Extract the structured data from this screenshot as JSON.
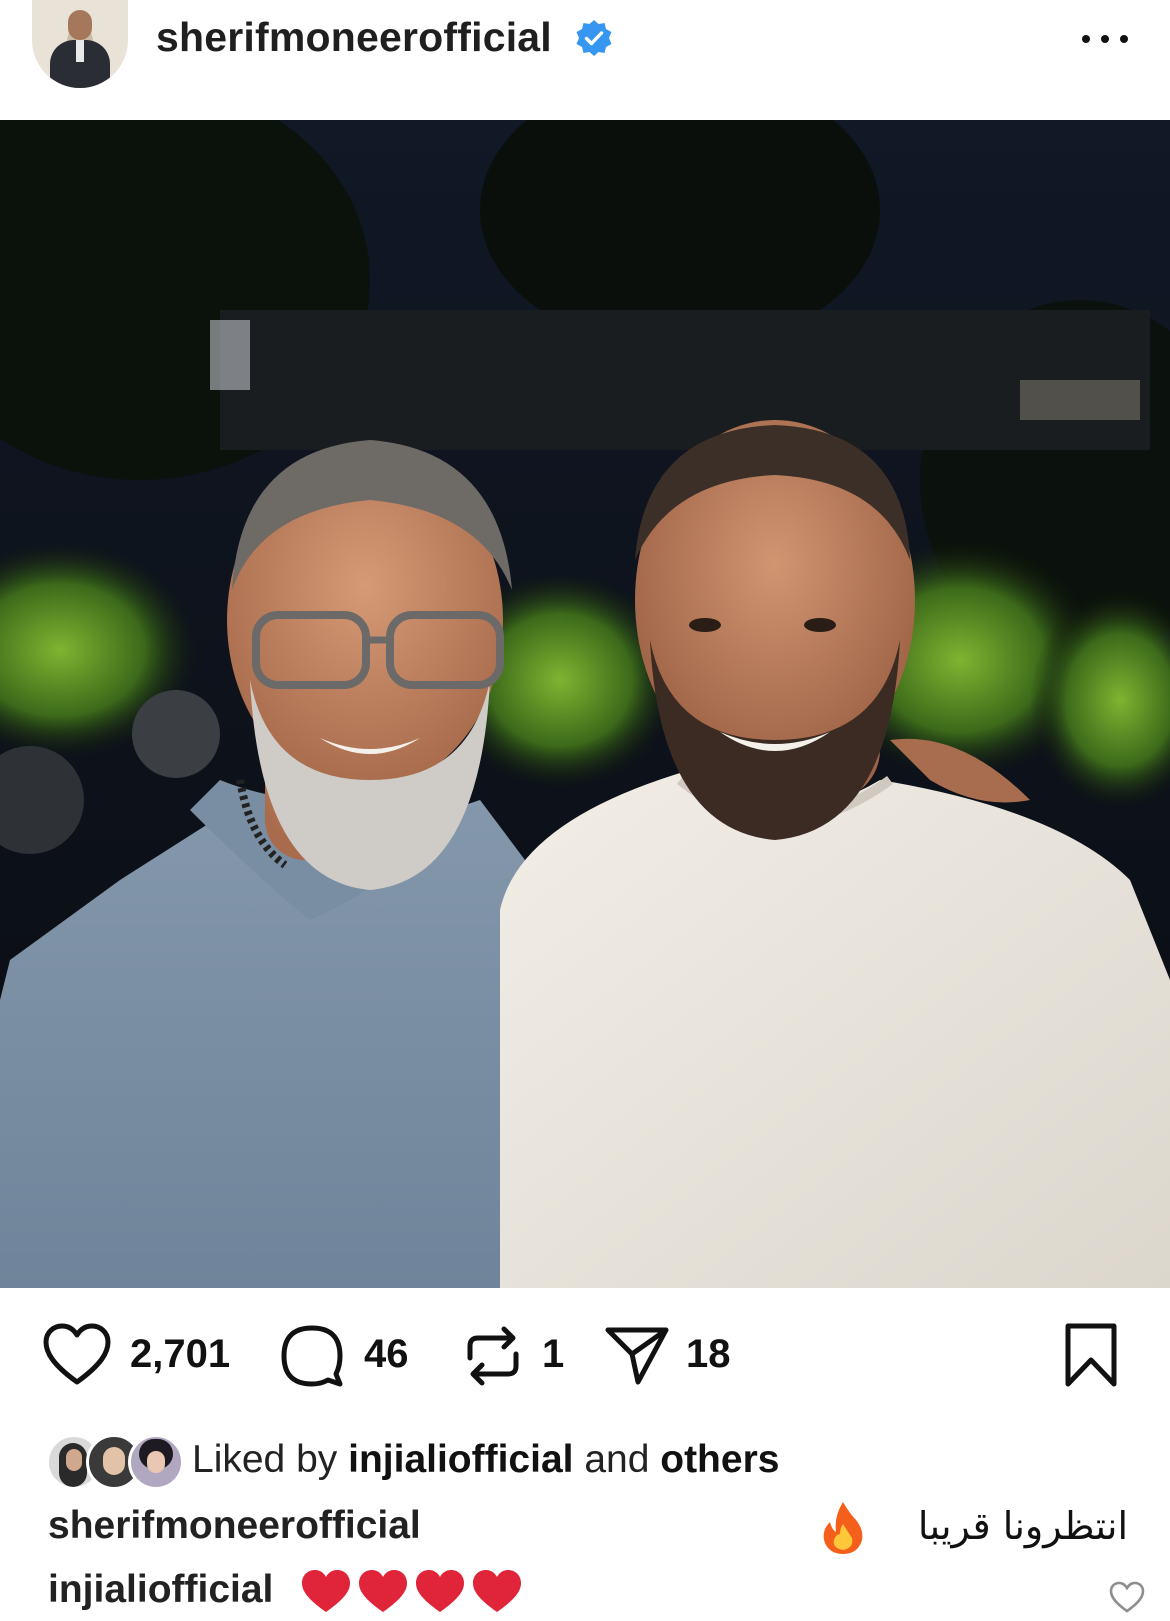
{
  "header": {
    "username": "sherifmoneerofficial",
    "verified": true,
    "more_icon": "more-horizontal-icon"
  },
  "post": {
    "image_alt_icon": "photo"
  },
  "actions": {
    "likes": "2,701",
    "comments": "46",
    "reposts": "1",
    "shares": "18"
  },
  "liked_by": {
    "prefix": "Liked by",
    "user": "injialiofficial",
    "joiner": "and",
    "others": "others"
  },
  "caption": {
    "username": "sherifmoneerofficial",
    "text": "انتظرونا قريبا",
    "emoji": "fire"
  },
  "comment": {
    "username": "injialiofficial",
    "hearts": 4
  },
  "colors": {
    "verified_blue": "#3797f0",
    "heart_red": "#e0243a"
  }
}
